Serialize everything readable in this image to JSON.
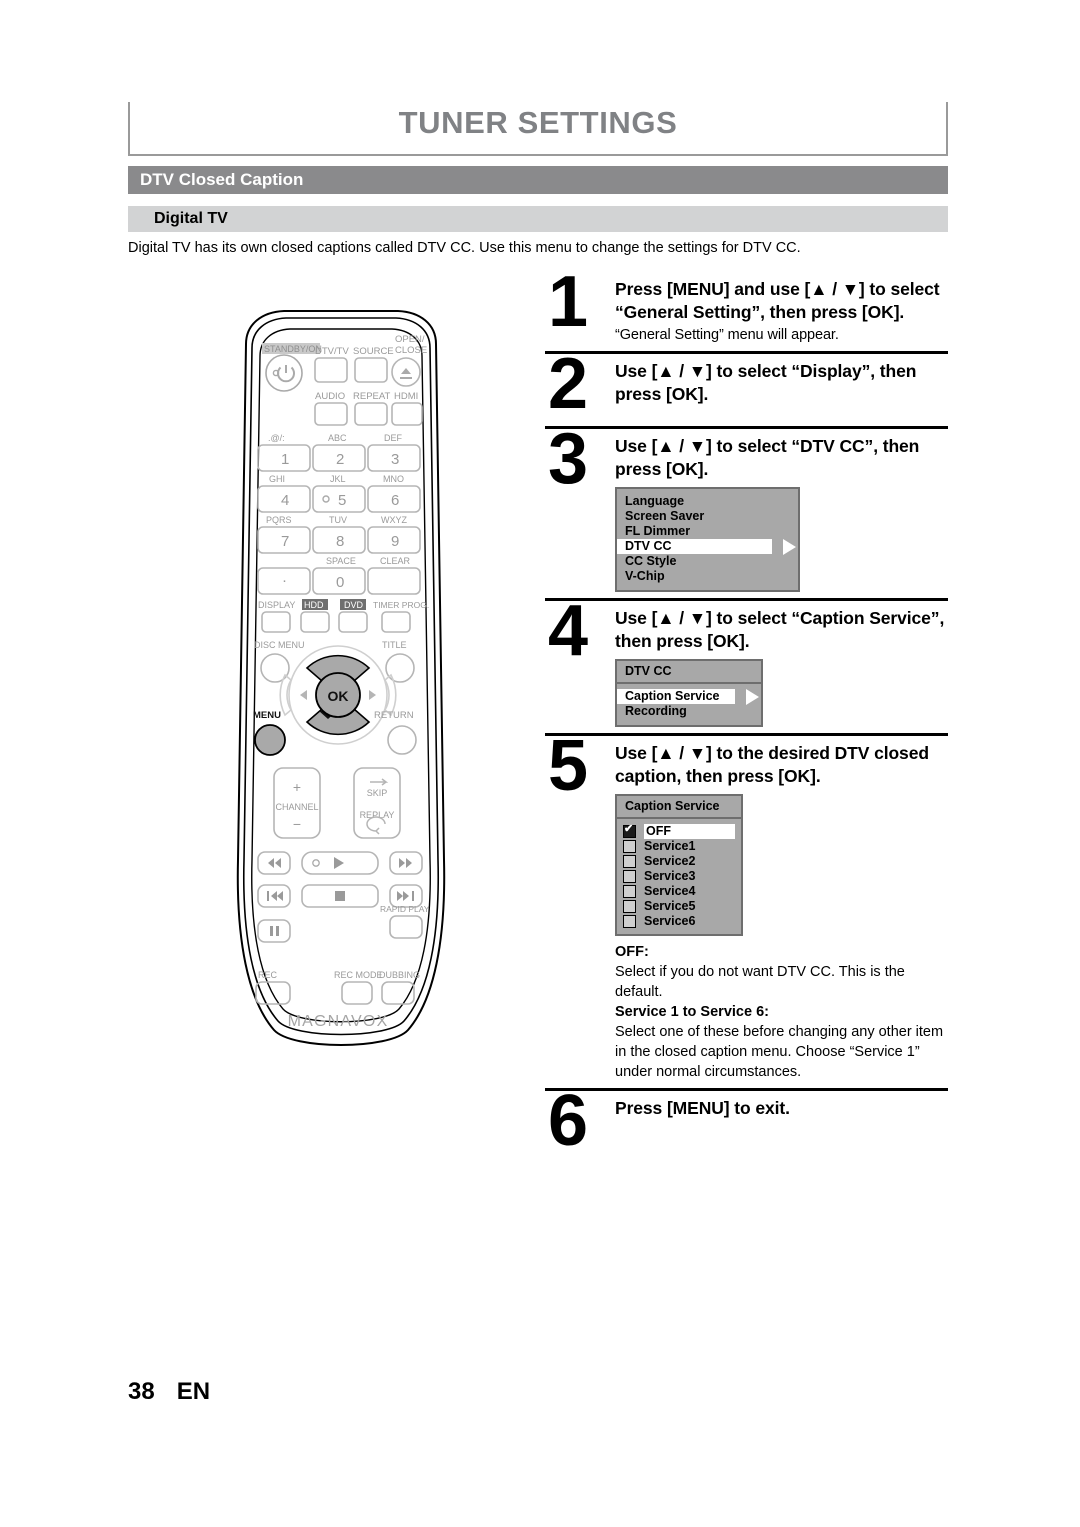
{
  "page": {
    "title": "TUNER SETTINGS",
    "section": "DTV Closed Caption",
    "subsection": "Digital TV",
    "intro": "Digital TV has its own closed captions called DTV CC. Use this menu to change the settings for DTV CC.",
    "footer_page": "38",
    "footer_lang": "EN"
  },
  "steps": [
    {
      "num": "1",
      "head_line1": "Press [MENU] and use [▲ / ▼] to select",
      "head_line2": "“General Setting”, then press [OK].",
      "sub": "“General Setting” menu will appear."
    },
    {
      "num": "2",
      "head_line1": "Use [▲ / ▼] to select “Display”, then",
      "head_line2": "press [OK].",
      "sub": ""
    },
    {
      "num": "3",
      "head_line1": "Use [▲ / ▼] to select “DTV CC”, then",
      "head_line2": "press [OK].",
      "sub": ""
    },
    {
      "num": "4",
      "head_line1": "Use [▲ / ▼] to select “Caption Service”,",
      "head_line2": "then press [OK].",
      "sub": ""
    },
    {
      "num": "5",
      "head_line1": "Use [▲ / ▼] to the desired DTV closed",
      "head_line2": "caption, then press [OK].",
      "sub": ""
    },
    {
      "num": "6",
      "head_line1": "Press [MENU] to exit.",
      "head_line2": "",
      "sub": ""
    }
  ],
  "osd_display_menu": {
    "items": [
      "Language",
      "Screen Saver",
      "FL Dimmer",
      "DTV CC",
      "CC Style",
      "V-Chip"
    ],
    "selected": "DTV CC"
  },
  "osd_dtvcc_menu": {
    "title": "DTV CC",
    "items": [
      "Caption Service",
      "Recording"
    ],
    "selected": "Caption Service"
  },
  "osd_caption_service_menu": {
    "title": "Caption Service",
    "items": [
      "OFF",
      "Service1",
      "Service2",
      "Service3",
      "Service4",
      "Service5",
      "Service6"
    ],
    "selected": "OFF"
  },
  "notes": {
    "off_label": "OFF:",
    "off_text": "Select if you do not want DTV CC. This is the default.",
    "service_label": "Service 1 to Service 6:",
    "service_text": "Select one of these before changing any other item in the closed caption menu. Choose “Service 1” under normal circumstances."
  },
  "remote": {
    "brand": "MAGNAVOX",
    "standby_label": "STANDBY/ON",
    "top_buttons": [
      "DTV/TV",
      "SOURCE",
      "OPEN/ CLOSE"
    ],
    "second_buttons": [
      "AUDIO",
      "REPEAT",
      "HDMI"
    ],
    "keypad": [
      {
        "top": ".@/:",
        "digit": "1"
      },
      {
        "top": "ABC",
        "digit": "2"
      },
      {
        "top": "DEF",
        "digit": "3"
      },
      {
        "top": "GHI",
        "digit": "4"
      },
      {
        "top": "JKL",
        "digit": "5"
      },
      {
        "top": "MNO",
        "digit": "6"
      },
      {
        "top": "PQRS",
        "digit": "7"
      },
      {
        "top": "TUV",
        "digit": "8"
      },
      {
        "top": "WXYZ",
        "digit": "9"
      },
      {
        "top": "",
        "digit": "·"
      },
      {
        "top": "SPACE",
        "digit": "0"
      },
      {
        "top": "CLEAR",
        "digit": ""
      }
    ],
    "row_display": [
      "DISPLAY",
      "HDD",
      "DVD",
      "TIMER PROG."
    ],
    "disc_menu": "DISC MENU",
    "title_btn": "TITLE",
    "ok_label": "OK",
    "menu_label": "MENU",
    "return_label": "RETURN",
    "channel_label": "CHANNEL",
    "channel_plus": "+",
    "channel_minus": "−",
    "skip_label": "SKIP",
    "replay_label": "REPLAY",
    "rapid_play": "RAPID PLAY",
    "rec_label": "REC",
    "rec_mode_label": "REC MODE",
    "dubbing_label": "DUBBING"
  },
  "colors": {
    "section_bar": "#8a8a8c",
    "subsection_bar": "#d2d3d4",
    "title_gray": "#808285",
    "osd_bg": "#a8a8a8",
    "highlight": "#b0b0b0"
  }
}
